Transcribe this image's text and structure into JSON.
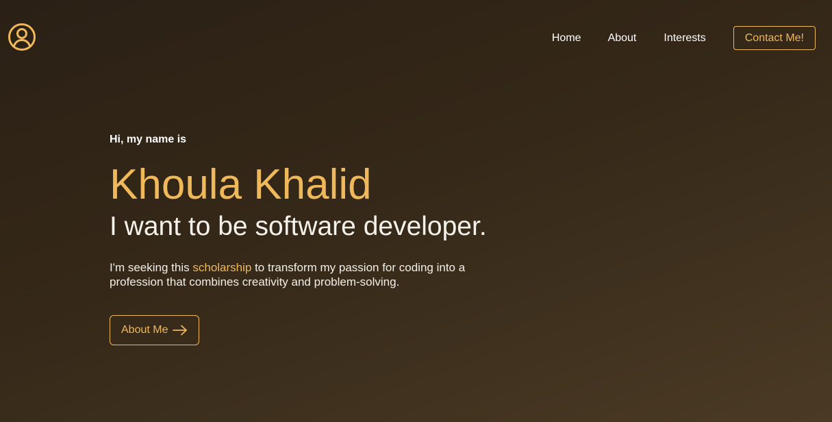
{
  "header": {
    "logo_icon": "user-circle-icon",
    "nav": {
      "home": "Home",
      "about": "About",
      "interests": "Interests",
      "contact": "Contact Me!"
    }
  },
  "hero": {
    "greeting": "Hi, my name is",
    "name": "Khoula Khalid",
    "tagline": "I want to be software developer.",
    "description_before": "I'm seeking this ",
    "description_highlight": "scholarship",
    "description_after": " to transform my passion for coding into a profession that combines creativity and problem-solving.",
    "button_label": "About Me",
    "button_icon": "arrow-right-icon"
  },
  "colors": {
    "accent": "#efb85a",
    "text": "#ffffff",
    "background_dark": "#2a2015",
    "background_light": "#4a3a25"
  }
}
